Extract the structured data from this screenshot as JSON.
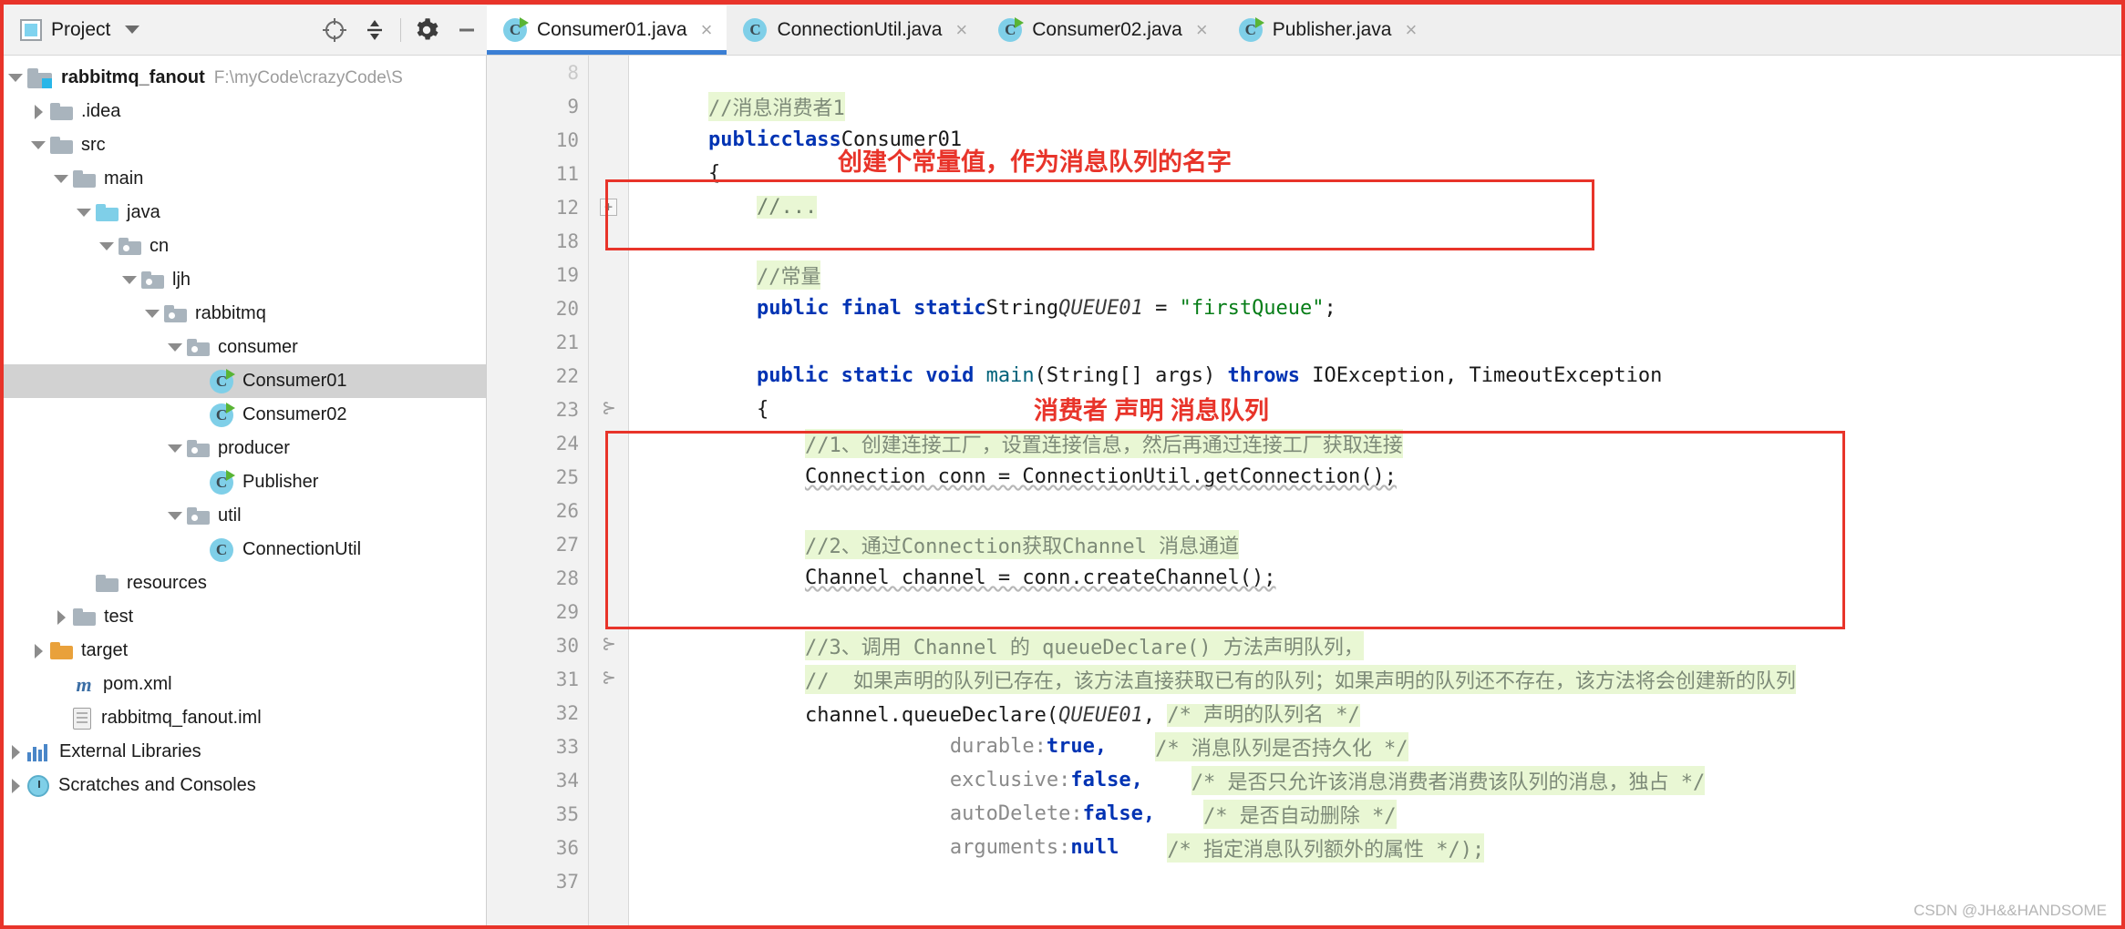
{
  "toolbar": {
    "project_label": "Project",
    "icons": [
      "locate-icon",
      "collapse-all-icon",
      "gear-icon",
      "minimize-icon"
    ]
  },
  "tabs": [
    {
      "label": "Consumer01.java",
      "active": true,
      "runnable": true,
      "close": "×"
    },
    {
      "label": "ConnectionUtil.java",
      "active": false,
      "runnable": false,
      "close": "×"
    },
    {
      "label": "Consumer02.java",
      "active": false,
      "runnable": true,
      "close": "×"
    },
    {
      "label": "Publisher.java",
      "active": false,
      "runnable": true,
      "close": "×"
    }
  ],
  "tree": {
    "items": [
      {
        "label": "rabbitmq_fanout",
        "path": "F:\\myCode\\crazyCode\\S",
        "indent": 0,
        "arrow": "open",
        "icon": "module-icon",
        "bold": true,
        "selected": false
      },
      {
        "label": ".idea",
        "path": "",
        "indent": 1,
        "arrow": "closed",
        "icon": "folder",
        "bold": false,
        "selected": false
      },
      {
        "label": "src",
        "path": "",
        "indent": 1,
        "arrow": "open",
        "icon": "folder",
        "bold": false,
        "selected": false
      },
      {
        "label": "main",
        "path": "",
        "indent": 2,
        "arrow": "open",
        "icon": "folder",
        "bold": false,
        "selected": false
      },
      {
        "label": "java",
        "path": "",
        "indent": 3,
        "arrow": "open",
        "icon": "folder-source-root",
        "bold": false,
        "selected": false
      },
      {
        "label": "cn",
        "path": "",
        "indent": 4,
        "arrow": "open",
        "icon": "folder-package",
        "bold": false,
        "selected": false
      },
      {
        "label": "ljh",
        "path": "",
        "indent": 5,
        "arrow": "open",
        "icon": "folder-package",
        "bold": false,
        "selected": false
      },
      {
        "label": "rabbitmq",
        "path": "",
        "indent": 6,
        "arrow": "open",
        "icon": "folder-package",
        "bold": false,
        "selected": false
      },
      {
        "label": "consumer",
        "path": "",
        "indent": 7,
        "arrow": "open",
        "icon": "folder-package",
        "bold": false,
        "selected": false
      },
      {
        "label": "Consumer01",
        "path": "",
        "indent": 8,
        "arrow": "none",
        "icon": "java-class-runnable",
        "bold": false,
        "selected": true
      },
      {
        "label": "Consumer02",
        "path": "",
        "indent": 8,
        "arrow": "none",
        "icon": "java-class-runnable",
        "bold": false,
        "selected": false
      },
      {
        "label": "producer",
        "path": "",
        "indent": 7,
        "arrow": "open",
        "icon": "folder-package",
        "bold": false,
        "selected": false
      },
      {
        "label": "Publisher",
        "path": "",
        "indent": 8,
        "arrow": "none",
        "icon": "java-class-runnable",
        "bold": false,
        "selected": false
      },
      {
        "label": "util",
        "path": "",
        "indent": 7,
        "arrow": "open",
        "icon": "folder-package",
        "bold": false,
        "selected": false
      },
      {
        "label": "ConnectionUtil",
        "path": "",
        "indent": 8,
        "arrow": "none",
        "icon": "java-class",
        "bold": false,
        "selected": false
      },
      {
        "label": "resources",
        "path": "",
        "indent": 3,
        "arrow": "none",
        "icon": "folder",
        "bold": false,
        "selected": false
      },
      {
        "label": "test",
        "path": "",
        "indent": 2,
        "arrow": "closed",
        "icon": "folder",
        "bold": false,
        "selected": false
      },
      {
        "label": "target",
        "path": "",
        "indent": 1,
        "arrow": "closed",
        "icon": "folder-target",
        "bold": false,
        "selected": false
      },
      {
        "label": "pom.xml",
        "path": "",
        "indent": 2,
        "arrow": "none",
        "icon": "maven-icon",
        "bold": false,
        "selected": false
      },
      {
        "label": "rabbitmq_fanout.iml",
        "path": "",
        "indent": 2,
        "arrow": "none",
        "icon": "iml-icon",
        "bold": false,
        "selected": false
      },
      {
        "label": "External Libraries",
        "path": "",
        "indent": 0,
        "arrow": "closed",
        "icon": "library-icon",
        "bold": false,
        "selected": false
      },
      {
        "label": "Scratches and Consoles",
        "path": "",
        "indent": 0,
        "arrow": "closed",
        "icon": "scratches-icon",
        "bold": false,
        "selected": false
      }
    ]
  },
  "editor": {
    "lines": [
      {
        "num": "8",
        "text": "",
        "type": "blank",
        "partial": true
      },
      {
        "num": "9",
        "type": "comment",
        "indent": 4,
        "text": "//消息消费者1"
      },
      {
        "num": "10",
        "type": "class-decl",
        "run": true,
        "indent": 4,
        "kw1": "public",
        "kw2": "class",
        "name": "Consumer01"
      },
      {
        "num": "11",
        "type": "plain",
        "indent": 4,
        "text": "{"
      },
      {
        "num": "12",
        "type": "folded",
        "indent": 8,
        "text": "//...",
        "fold": "+"
      },
      {
        "num": "18",
        "type": "blank",
        "text": ""
      },
      {
        "num": "19",
        "type": "comment",
        "indent": 8,
        "text": "//常量"
      },
      {
        "num": "20",
        "type": "const-decl",
        "indent": 8,
        "kw": "public final static",
        "typ": "String",
        "field": "QUEUE01",
        "eq": " = ",
        "val": "\"firstQueue\"",
        "semi": ";"
      },
      {
        "num": "21",
        "type": "blank",
        "text": ""
      },
      {
        "num": "22",
        "type": "main-decl",
        "run": true,
        "indent": 8,
        "text": "public static void main(String[] args) throws IOException, TimeoutException"
      },
      {
        "num": "23",
        "type": "plain",
        "indent": 8,
        "text": "{",
        "fold": "brace"
      },
      {
        "num": "24",
        "type": "comment",
        "indent": 12,
        "text": "//1、创建连接工厂，设置连接信息，然后再通过连接工厂获取连接"
      },
      {
        "num": "25",
        "type": "code",
        "indent": 12,
        "text": "Connection conn = ConnectionUtil.getConnection();"
      },
      {
        "num": "26",
        "type": "blank",
        "text": ""
      },
      {
        "num": "27",
        "type": "comment",
        "indent": 12,
        "text": "//2、通过Connection获取Channel 消息通道"
      },
      {
        "num": "28",
        "type": "code",
        "indent": 12,
        "text": "Channel channel = conn.createChannel();"
      },
      {
        "num": "29",
        "type": "blank",
        "text": ""
      },
      {
        "num": "30",
        "type": "comment",
        "indent": 12,
        "text": "//3、调用 Channel 的 queueDeclare() 方法声明队列，",
        "fold": "brace"
      },
      {
        "num": "31",
        "type": "comment",
        "indent": 12,
        "text": "//  如果声明的队列已存在，该方法直接获取已有的队列；如果声明的队列还不存在，该方法将会创建新的队列",
        "fold": "brace"
      },
      {
        "num": "32",
        "type": "declare-call",
        "indent": 12,
        "text": "channel.queueDeclare(QUEUE01, /* 声明的队列名 */"
      },
      {
        "num": "33",
        "type": "param",
        "indent": 24,
        "name": "durable:",
        "value": "true,",
        "comment": "/* 消息队列是否持久化 */"
      },
      {
        "num": "34",
        "type": "param",
        "indent": 24,
        "name": "exclusive:",
        "value": "false,",
        "comment": "/* 是否只允许该消息消费者消费该队列的消息，独占 */"
      },
      {
        "num": "35",
        "type": "param",
        "indent": 24,
        "name": "autoDelete:",
        "value": "false,",
        "comment": "/* 是否自动删除 */"
      },
      {
        "num": "36",
        "type": "param",
        "indent": 24,
        "name": "arguments:",
        "value": "null",
        "comment": "/* 指定消息队列额外的属性 */);"
      },
      {
        "num": "37",
        "type": "blank",
        "text": ""
      }
    ]
  },
  "annotations": [
    {
      "name": "queue-name-constant-note",
      "text": "创建个常量值，作为消息队列的名字"
    },
    {
      "name": "consumer-declare-queue-note",
      "text": "消费者 声明 消息队列"
    }
  ],
  "watermark": "CSDN @JH&&HANDSOME",
  "colors": {
    "annotation_red": "#e8342a",
    "tab_active_underline": "#3b7fd4",
    "comment_highlight": "#e9f7d4",
    "keyword_blue": "#0033b3",
    "string_green": "#067d17",
    "selection_gray": "#d2d2d2"
  }
}
